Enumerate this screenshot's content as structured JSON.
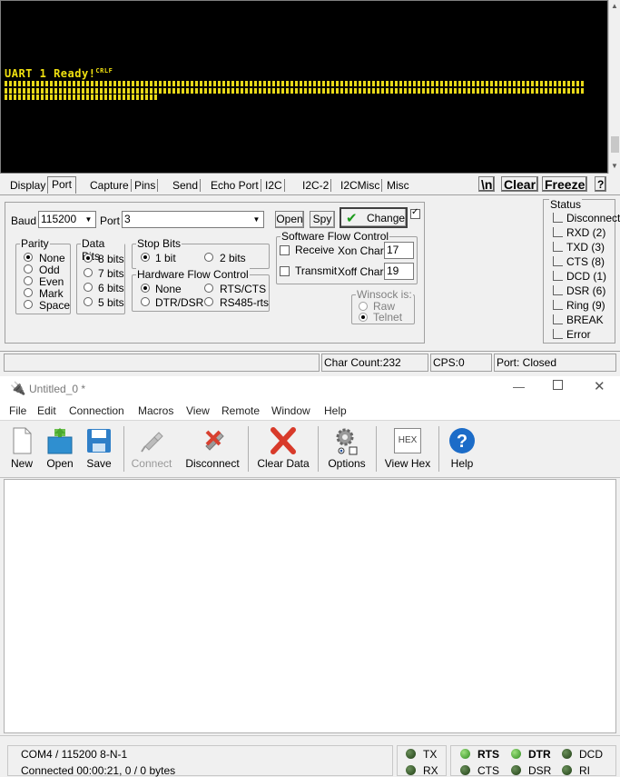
{
  "terminal": {
    "ready_text": "UART 1 Ready!",
    "crlf_marker": "CRLF"
  },
  "tabs": [
    "Display",
    "Port",
    "Capture",
    "Pins",
    "Send",
    "Echo Port",
    "I2C",
    "I2C-2",
    "I2CMisc",
    "Misc"
  ],
  "tab_active": "Port",
  "tab_buttons": {
    "newline": "\\n",
    "clear": "Clear",
    "freeze": "Freeze",
    "help": "?"
  },
  "port": {
    "baud_label": "Baud",
    "baud_value": "115200",
    "port_label": "Port",
    "port_value": "3",
    "open_label": "Open",
    "spy_label": "Spy",
    "change_label": "Change",
    "change_checked": true,
    "parity": {
      "title": "Parity",
      "options": [
        "None",
        "Odd",
        "Even",
        "Mark",
        "Space"
      ],
      "selected": "None"
    },
    "databits": {
      "title": "Data Bits",
      "options": [
        "8 bits",
        "7 bits",
        "6 bits",
        "5 bits"
      ],
      "selected": "8 bits"
    },
    "stopbits": {
      "title": "Stop Bits",
      "options": [
        "1 bit",
        "2 bits"
      ],
      "selected": "1 bit"
    },
    "hwflow": {
      "title": "Hardware Flow Control",
      "options": [
        "None",
        "RTS/CTS",
        "DTR/DSR",
        "RS485-rts"
      ],
      "selected": "None"
    },
    "swflow": {
      "title": "Software Flow Control",
      "receive": "Receive",
      "transmit": "Transmit",
      "xon_label": "Xon Char:",
      "xon_value": "17",
      "xoff_label": "Xoff Char:",
      "xoff_value": "19"
    },
    "winsock": {
      "title": "Winsock is:",
      "options": [
        "Raw",
        "Telnet"
      ],
      "selected": "Telnet"
    }
  },
  "status": {
    "title": "Status",
    "items": [
      "Disconnect",
      "RXD (2)",
      "TXD (3)",
      "CTS (8)",
      "DCD (1)",
      "DSR (6)",
      "Ring (9)",
      "BREAK",
      "Error"
    ]
  },
  "statusbar": {
    "char_count": "Char Count:232",
    "cps": "CPS:0",
    "port": "Port: Closed"
  },
  "window2": {
    "title": "Untitled_0 *",
    "menu": [
      "File",
      "Edit",
      "Connection",
      "Macros",
      "View",
      "Remote",
      "Window",
      "Help"
    ],
    "toolbar": [
      "New",
      "Open",
      "Save",
      "Connect",
      "Disconnect",
      "Clear Data",
      "Options",
      "View Hex",
      "Help"
    ],
    "hex_icon_text": "HEX",
    "bottom": {
      "line1": "COM4 / 115200 8-N-1",
      "line2": "Connected 00:00:21, 0 / 0 bytes",
      "tx": "TX",
      "rx": "RX",
      "rts": "RTS",
      "cts": "CTS",
      "dtr": "DTR",
      "dsr": "DSR",
      "dcd": "DCD",
      "ri": "RI"
    }
  }
}
